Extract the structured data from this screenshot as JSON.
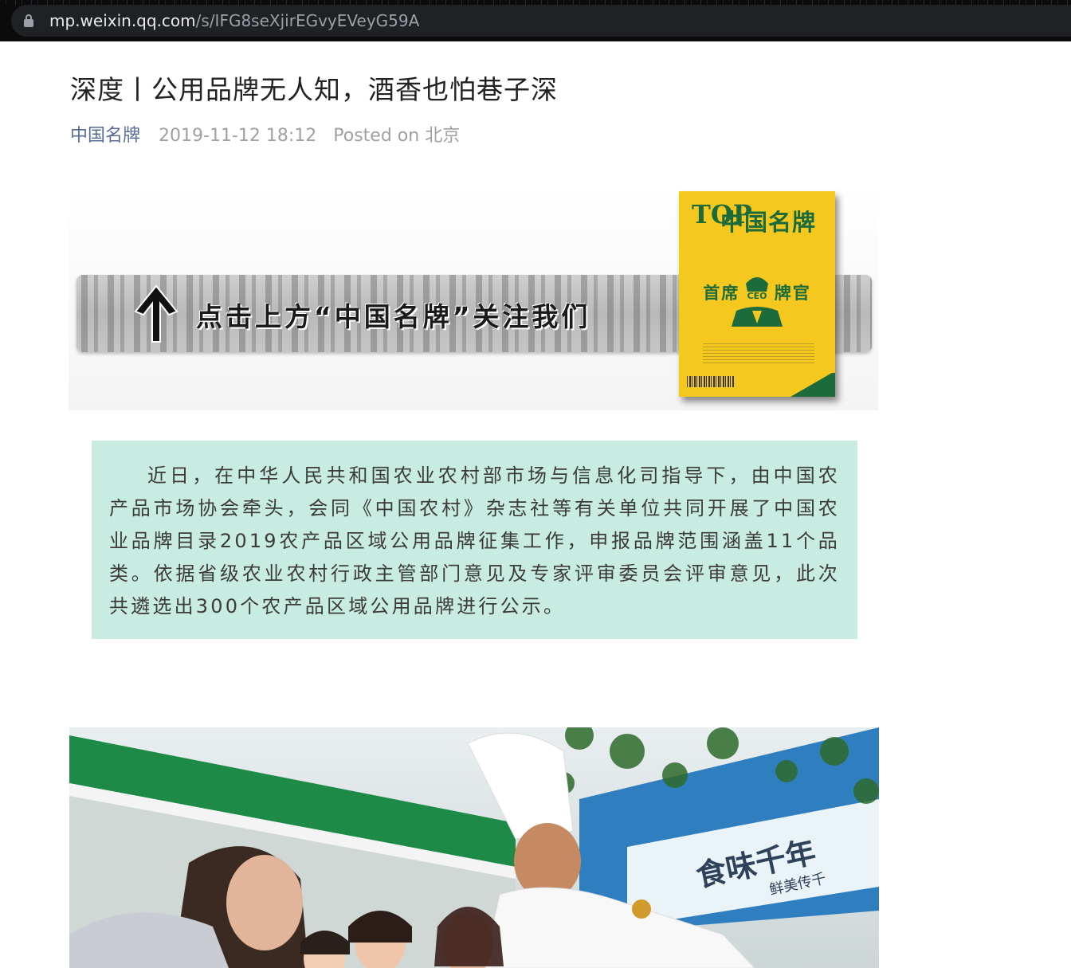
{
  "browser": {
    "url_host": "mp.weixin.qq.com",
    "url_path": "/s/IFG8seXjirEGvyEVeyG59A",
    "lock_icon": "lock-icon"
  },
  "article": {
    "title": "深度丨公用品牌无人知，酒香也怕巷子深",
    "account_name": "中国名牌",
    "publish_time": "2019-11-12 18:12",
    "location_prefix": "Posted on",
    "location": "北京"
  },
  "banner": {
    "call_to_action": "点击上方“中国名牌”关注我们",
    "magazine": {
      "logo_latin": "TOP",
      "logo_cn": "中国名牌",
      "headline_left": "首席",
      "headline_mid": "CEO",
      "headline_right": "牌官"
    }
  },
  "intro": {
    "text": "近日，在中华人民共和国农业农村部市场与信息化司指导下，由中国农产品市场协会牵头，会同《中国农村》杂志社等有关单位共同开展了中国农业品牌目录2019农产品区域公用品牌征集工作，申报品牌范围涵盖11个品类。依据省级农业农村行政主管部门意见及专家评审委员会评审意见，此次共遴选出300个农产品区域公用品牌进行公示。",
    "background_color": "#c9ece2"
  },
  "photo": {
    "sign_text": "食味千年",
    "sign_sub": "鲜美传千"
  }
}
